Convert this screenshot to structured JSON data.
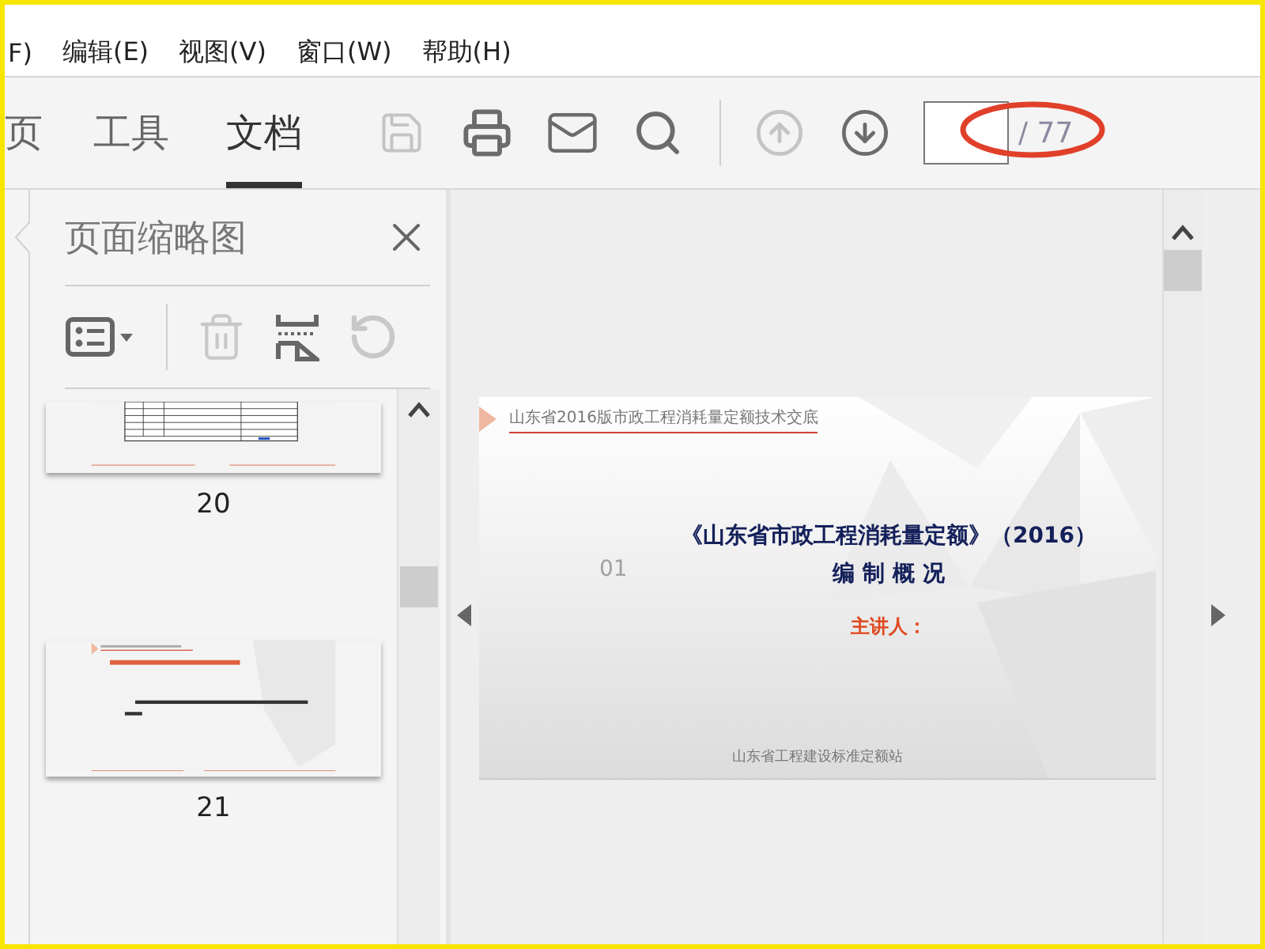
{
  "menu": [
    {
      "label": "F)"
    },
    {
      "label": "编辑(E)"
    },
    {
      "label": "视图(V)"
    },
    {
      "label": "窗口(W)"
    },
    {
      "label": "帮助(H)"
    }
  ],
  "tabs": [
    {
      "label": "页",
      "selected": false
    },
    {
      "label": "工具",
      "selected": false
    },
    {
      "label": "文档",
      "selected": true
    }
  ],
  "toolbar": [
    {
      "kind": "save",
      "disabled": true
    },
    {
      "kind": "print",
      "disabled": false
    },
    {
      "kind": "mail",
      "disabled": false
    },
    {
      "kind": "search",
      "disabled": false
    },
    {
      "kind": "divider"
    },
    {
      "kind": "up",
      "disabled": true
    },
    {
      "kind": "down",
      "disabled": false
    }
  ],
  "page": {
    "total": "/ 77"
  },
  "annotation": {
    "kind": "ellipse"
  },
  "panel": {
    "title": "页面缩略图",
    "tools": [
      {
        "kind": "options",
        "disabled": false
      },
      {
        "kind": "divider"
      },
      {
        "kind": "delete",
        "disabled": true
      },
      {
        "kind": "extract",
        "disabled": false
      },
      {
        "kind": "rotate",
        "disabled": true
      }
    ],
    "thumbnails": [
      {
        "label": "20",
        "kind": "table"
      },
      {
        "label": "21",
        "kind": "text"
      }
    ]
  },
  "slide": {
    "header": "山东省2016版市政工程消耗量定额技术交底",
    "number": "01",
    "title": "《山东省市政工程消耗量定额》（2016）",
    "subtitle": "编 制 概 况",
    "speaker": "主讲人：",
    "footer": "山东省工程建设标准定额站"
  }
}
